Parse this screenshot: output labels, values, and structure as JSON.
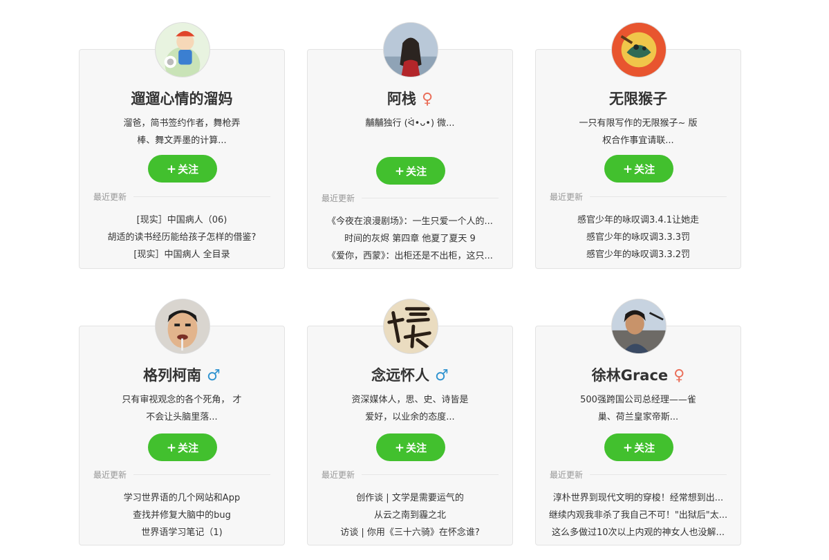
{
  "follow_label": "关注",
  "follow_icon": "plus-icon",
  "recent_label": "最近更新",
  "colors": {
    "follow_green": "#42c02e",
    "female": "#ea6f5a",
    "male": "#3194d0",
    "card_bg": "#f7f7f7"
  },
  "authors": [
    {
      "name": "遛遛心情的溜妈",
      "gender": "",
      "intro_lines": [
        "溜爸，简书签约作者，舞枪弄",
        "棒、舞文弄墨的计算..."
      ],
      "recent": [
        "[现实］中国病人（06)",
        "胡适的读书经历能给孩子怎样的借鉴?",
        "[现实］中国病人 全目录"
      ]
    },
    {
      "name": "阿栈",
      "gender": "♀",
      "intro_lines": [
        "黼黼独行 (ᐛ•ᴗ•) 微..."
      ],
      "recent": [
        "《今夜在浪漫剧场》：一生只爱一个人的...",
        "时间的灰烬 第四章 他夏了夏天 9",
        "《爱你，西蒙》：出柜还是不出柜，这只..."
      ]
    },
    {
      "name": "无限猴子",
      "gender": "",
      "intro_lines": [
        "一只有限写作的无限猴子~ 版",
        "权合作事宜请联..."
      ],
      "recent": [
        "感官少年的咏叹调3.4.1让她走",
        "感官少年的咏叹调3.3.3罚",
        "感官少年的咏叹调3.3.2罚"
      ]
    },
    {
      "name": "格列柯南",
      "gender": "♂",
      "intro_lines": [
        "只有审视观念的各个死角， 才",
        "不会让头脑里落..."
      ],
      "recent": [
        "学习世界语的几个网站和App",
        "查找并修复大脑中的bug",
        "世界语学习笔记（1)"
      ]
    },
    {
      "name": "念远怀人",
      "gender": "♂",
      "intro_lines": [
        "资深媒体人，思、史、诗皆是",
        "爱好，以业余的态度..."
      ],
      "recent": [
        "创作谈 | 文学是需要运气的",
        "从云之南到霾之北",
        "访谈 | 你用《三十六骑》在怀念谁?"
      ]
    },
    {
      "name": "徐林Grace",
      "gender": "♀",
      "intro_lines": [
        "500强跨国公司总经理——雀",
        "巢、荷兰皇家帝斯..."
      ],
      "recent": [
        "淳朴世界到现代文明的穿梭！经常想到出...",
        "继续内观我非杀了我自己不可！\"出狱后\"太...",
        "这么多做过10次以上内观的神女人也没解..."
      ]
    }
  ]
}
